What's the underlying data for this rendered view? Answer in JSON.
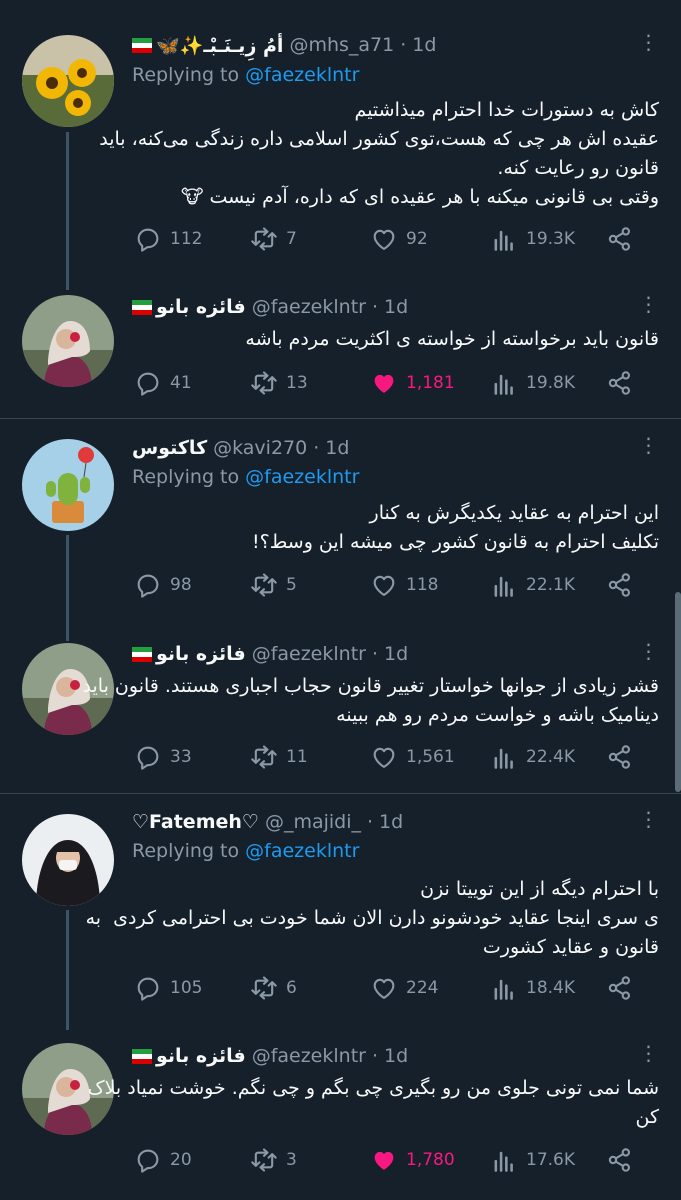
{
  "tweets": [
    {
      "name": "أمُ زِیـنَـبْ‍ـ✨🦋",
      "handle": "@mhs_a71",
      "time": "1d",
      "replying_prefix": "Replying to ",
      "replying_handle": "@faezeklntr",
      "lines": [
        "کاش به دستورات خدا احترام میذاشتیم",
        "عقیده اش هر چی که هست،توی کشور اسلامی داره زندگی می‌کنه، باید",
        "قانون رو رعایت کنه.",
        "وقتی بی قانونی میکنه با هر عقیده ای که داره، آدم نیست 🐮"
      ],
      "replies": "112",
      "retweets": "7",
      "likes": "92",
      "views": "19.3K"
    },
    {
      "name": "فائزه بانو",
      "handle": "@faezeklntr",
      "time": "1d",
      "lines": [
        "قانون باید برخواسته از خواسته ی اکثریت مردم باشه"
      ],
      "replies": "41",
      "retweets": "13",
      "likes": "1,181",
      "views": "19.8K"
    },
    {
      "name": "کاکتوس",
      "handle": "@kavi270",
      "time": "1d",
      "replying_prefix": "Replying to ",
      "replying_handle": "@faezeklntr",
      "lines": [
        "این احترام به عقاید یکدیگرش به کنار",
        "تکلیف احترام به قانون کشور چی میشه این وسط؟!"
      ],
      "replies": "98",
      "retweets": "5",
      "likes": "118",
      "views": "22.1K"
    },
    {
      "name": "فائزه بانو",
      "handle": "@faezeklntr",
      "time": "1d",
      "lines": [
        "قشر زیادی از جوانها خواستار تغییر قانون حجاب اجباری هستند. قانون باید",
        "دینامیک باشه و خواست مردم رو هم ببینه"
      ],
      "replies": "33",
      "retweets": "11",
      "likes": "1,561",
      "views": "22.4K"
    },
    {
      "name": "♡Fatemeh♡",
      "handle": "@_majidi_",
      "time": "1d",
      "replying_prefix": "Replying to ",
      "replying_handle": "@faezeklntr",
      "lines": [
        "با احترام دیگه از این توییتا نزن",
        "ی سری اینجا عقاید خودشونو دارن الان شما خودت بی احترامی کردی  به",
        "قانون و عقاید کشورت"
      ],
      "replies": "105",
      "retweets": "6",
      "likes": "224",
      "views": "18.4K"
    },
    {
      "name": "فائزه بانو",
      "handle": "@faezeklntr",
      "time": "1d",
      "lines": [
        "شما نمی تونی جلوی من رو بگیری چی بگم و چی نگم. خوشت نمیاد بلاک",
        "کن"
      ],
      "replies": "20",
      "retweets": "3",
      "likes": "1,780",
      "views": "17.6K"
    }
  ],
  "separator_char": "·",
  "more_glyph": "⋮",
  "colors": {
    "background": "#15202b",
    "text": "#f7f9f9",
    "muted": "#8b98a5",
    "link": "#1d9bf0",
    "like": "#f91880",
    "divider": "#38444d"
  }
}
